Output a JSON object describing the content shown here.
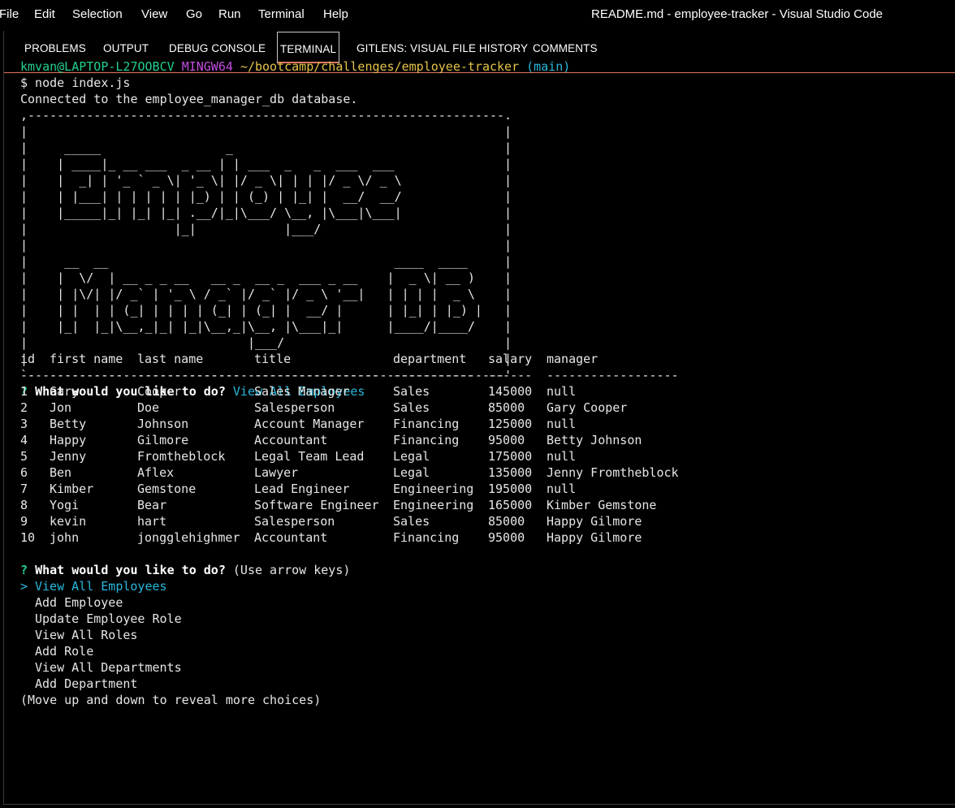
{
  "menu": [
    "File",
    "Edit",
    "Selection",
    "View",
    "Go",
    "Run",
    "Terminal",
    "Help"
  ],
  "window_title": "README.md - employee-tracker - Visual Studio Code",
  "panel_tabs": [
    "PROBLEMS",
    "OUTPUT",
    "DEBUG CONSOLE",
    "TERMINAL",
    "GITLENS: VISUAL FILE HISTORY",
    "COMMENTS"
  ],
  "active_tab": "TERMINAL",
  "prompt": {
    "user": "kmvan@LAPTOP-L27OOBCV",
    "shell": "MINGW64",
    "path": "~/bootcamp/challenges/employee-tracker",
    "branch": "(main)"
  },
  "command": "$ node index.js",
  "connected_msg": "Connected to the employee_manager_db database.",
  "banner": [
    ",-----------------------------------------------------------------.",
    "|                                                                 |",
    "|     _____                 _                                     |",
    "|    | ____|_ __ ___  _ __ | | ___  _   _  ___  ___               |",
    "|    |  _| | '_ ` _ \\| '_ \\| |/ _ \\| | | |/ _ \\/ _ \\              |",
    "|    | |___| | | | | | |_) | | (_) | |_| |  __/  __/              |",
    "|    |_____|_| |_| |_| .__/|_|\\___/ \\__, |\\___|\\___|              |",
    "|                    |_|            |___/                         |",
    "|                                                                 |",
    "|     __  __                                       ____  ____     |",
    "|    |  \\/  | __ _ _ __   __ _  __ _  ___ _ __    |  _ \\| __ )    |",
    "|    | |\\/| |/ _` | '_ \\ / _` |/ _` |/ _ \\ '__|   | | | |  _ \\    |",
    "|    | |  | | (_| | | | | (_| | (_| |  __/ |      | |_| | |_) |   |",
    "|    |_|  |_|\\__,_|_| |_|\\__,_|\\__, |\\___|_|      |____/|____/    |",
    "|                              |___/                              |",
    "|                                                                 |",
    "`-----------------------------------------------------------------'"
  ],
  "question1": {
    "mark": "?",
    "text": "What would you like to do?",
    "answer": "View All Employees"
  },
  "table": {
    "headers": [
      "id",
      "first name",
      "last name",
      "title",
      "department",
      "salary",
      "manager"
    ],
    "dividers": [
      "--",
      "----------",
      "--------------",
      "-----------------",
      "-----------",
      "------",
      "------------------"
    ],
    "rows": [
      [
        "1",
        "Gary",
        "Cooper",
        "Sales Manager",
        "Sales",
        "145000",
        "null"
      ],
      [
        "2",
        "Jon",
        "Doe",
        "Salesperson",
        "Sales",
        "85000",
        "Gary Cooper"
      ],
      [
        "3",
        "Betty",
        "Johnson",
        "Account Manager",
        "Financing",
        "125000",
        "null"
      ],
      [
        "4",
        "Happy",
        "Gilmore",
        "Accountant",
        "Financing",
        "95000",
        "Betty Johnson"
      ],
      [
        "5",
        "Jenny",
        "Fromtheblock",
        "Legal Team Lead",
        "Legal",
        "175000",
        "null"
      ],
      [
        "6",
        "Ben",
        "Aflex",
        "Lawyer",
        "Legal",
        "135000",
        "Jenny Fromtheblock"
      ],
      [
        "7",
        "Kimber",
        "Gemstone",
        "Lead Engineer",
        "Engineering",
        "195000",
        "null"
      ],
      [
        "8",
        "Yogi",
        "Bear",
        "Software Engineer",
        "Engineering",
        "165000",
        "Kimber Gemstone"
      ],
      [
        "9",
        "kevin",
        "hart",
        "Salesperson",
        "Sales",
        "85000",
        "Happy Gilmore"
      ],
      [
        "10",
        "john",
        "jongglehighmer",
        "Accountant",
        "Financing",
        "95000",
        "Happy Gilmore"
      ]
    ]
  },
  "question2": {
    "mark": "?",
    "text": "What would you like to do?",
    "hint": "(Use arrow keys)"
  },
  "choices": {
    "pointer": ">",
    "selected": "View All Employees",
    "others": [
      "Add Employee",
      "Update Employee Role",
      "View All Roles",
      "Add Role",
      "View All Departments",
      "Add Department"
    ]
  },
  "more_hint": "(Move up and down to reveal more choices)"
}
